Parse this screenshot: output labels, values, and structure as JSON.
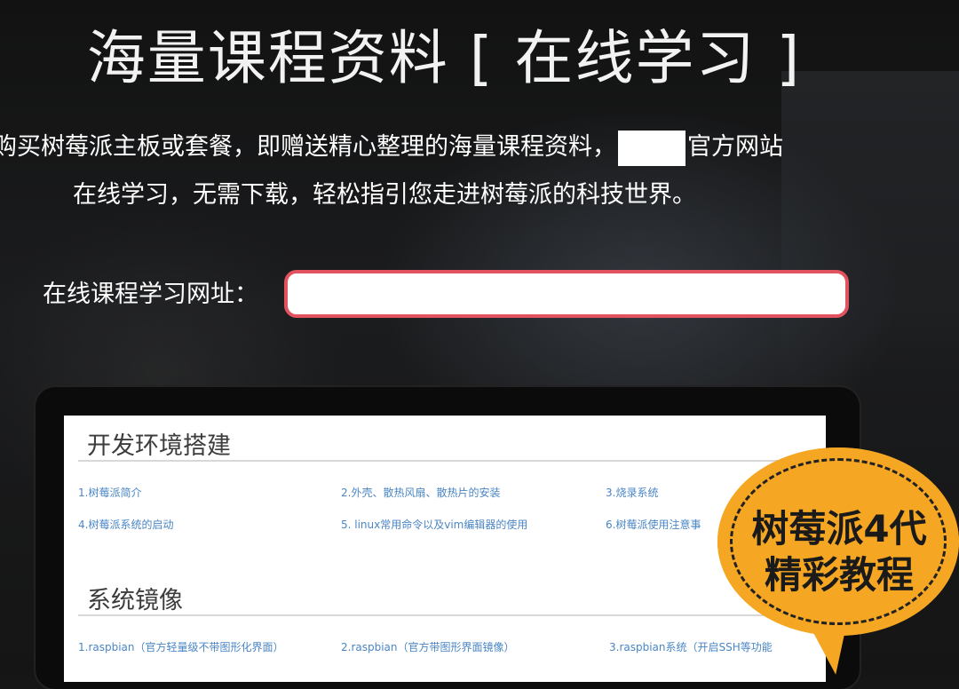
{
  "header": {
    "title": "海量课程资料 [ 在线学习 ]"
  },
  "intro": {
    "line1_before": "购买树莓派主板或套餐，即赠送精心整理的海量课程资料，",
    "line1_after": "官方网站",
    "line2": "在线学习，无需下载，轻松指引您走进树莓派的科技世界。"
  },
  "url_section": {
    "label": "在线课程学习网址：",
    "value": ""
  },
  "screen": {
    "sections": [
      {
        "heading": "开发环境搭建",
        "links": [
          "1.树莓派简介",
          "2.外壳、散热风扇、散热片的安装",
          "3.烧录系统",
          "4.树莓派系统的启动",
          "5. linux常用命令以及vim编辑器的使用",
          "6.树莓派使用注意事"
        ]
      },
      {
        "heading": "系统镜像",
        "links": [
          "1.raspbian（官方轻量级不带图形化界面）",
          "2.raspbian（官方带图形界面镜像）",
          "3.raspbian系统（开启SSH等功能"
        ]
      }
    ]
  },
  "badge": {
    "line1": "树莓派4代",
    "line2": "精彩教程",
    "color": "#f5a623"
  },
  "colors": {
    "field_border": "#e3535f",
    "link": "#4a86c5"
  }
}
